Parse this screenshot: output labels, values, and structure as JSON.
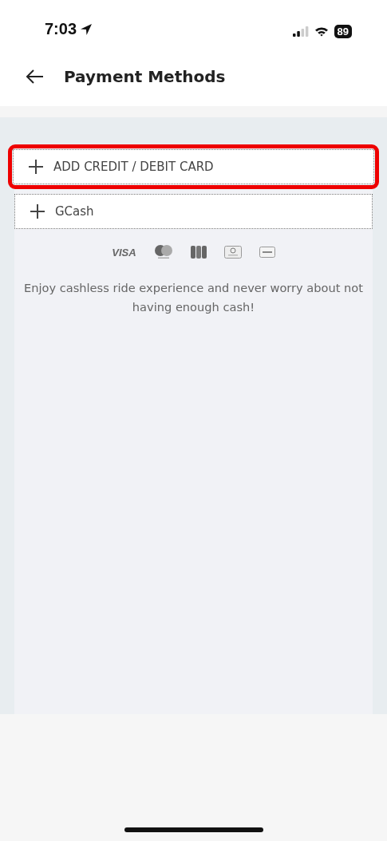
{
  "status_bar": {
    "time": "7:03",
    "battery": "89"
  },
  "header": {
    "title": "Payment Methods"
  },
  "options": [
    {
      "label": "ADD CREDIT / DEBIT CARD",
      "highlighted": true
    },
    {
      "label": "GCash",
      "highlighted": false
    }
  ],
  "card_logos": [
    {
      "kind": "visa",
      "label": "VISA"
    },
    {
      "kind": "mastercard"
    },
    {
      "kind": "jcb"
    },
    {
      "kind": "diners"
    },
    {
      "kind": "discover"
    }
  ],
  "message": "Enjoy cashless ride experience and never worry about not having enough cash!"
}
